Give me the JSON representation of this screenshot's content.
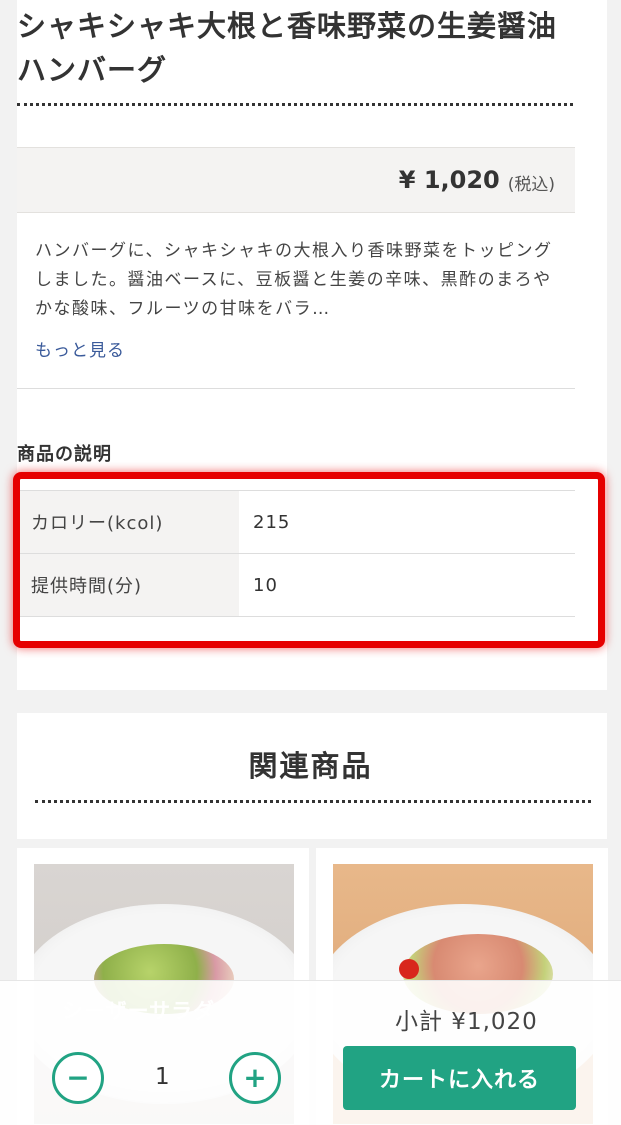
{
  "product": {
    "title": "シャキシャキ大根と香味野菜の生姜醤油ハンバーグ",
    "price": "¥ 1,020",
    "tax_note": "(税込)",
    "description": "ハンバーグに、シャキシャキの大根入り香味野菜をトッピングしました。醤油ベースに、豆板醤と生姜の辛味、黒酢のまろやかな酸味、フルーツの甘味をバラ…",
    "more_link": "もっと見る"
  },
  "spec": {
    "section_label": "商品の説明",
    "rows": [
      {
        "key": "カロリー(kcol)",
        "value": "215"
      },
      {
        "key": "提供時間(分)",
        "value": "10"
      }
    ]
  },
  "related": {
    "title": "関連商品",
    "ghost_item_name": "シーザーサラダ"
  },
  "footer": {
    "subtotal": "小計 ¥1,020",
    "quantity": "1",
    "minus_symbol": "−",
    "plus_symbol": "+",
    "cart_button": "カートに入れる"
  },
  "colors": {
    "accent": "#21a383",
    "highlight": "#e60000"
  }
}
